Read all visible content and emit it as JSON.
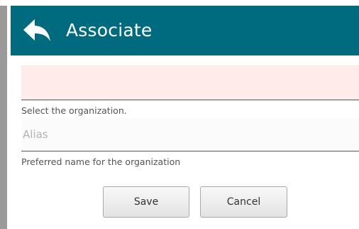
{
  "header": {
    "title": "Associate",
    "back_icon": "reply-arrow-icon",
    "background_color": "#006b7f"
  },
  "form": {
    "organization": {
      "value": "",
      "hint": "Select the organization.",
      "background_color": "#fdecea"
    },
    "alias": {
      "value": "",
      "placeholder": "Alias",
      "hint": "Preferred name for the organization"
    }
  },
  "actions": {
    "save_label": "Save",
    "cancel_label": "Cancel"
  }
}
